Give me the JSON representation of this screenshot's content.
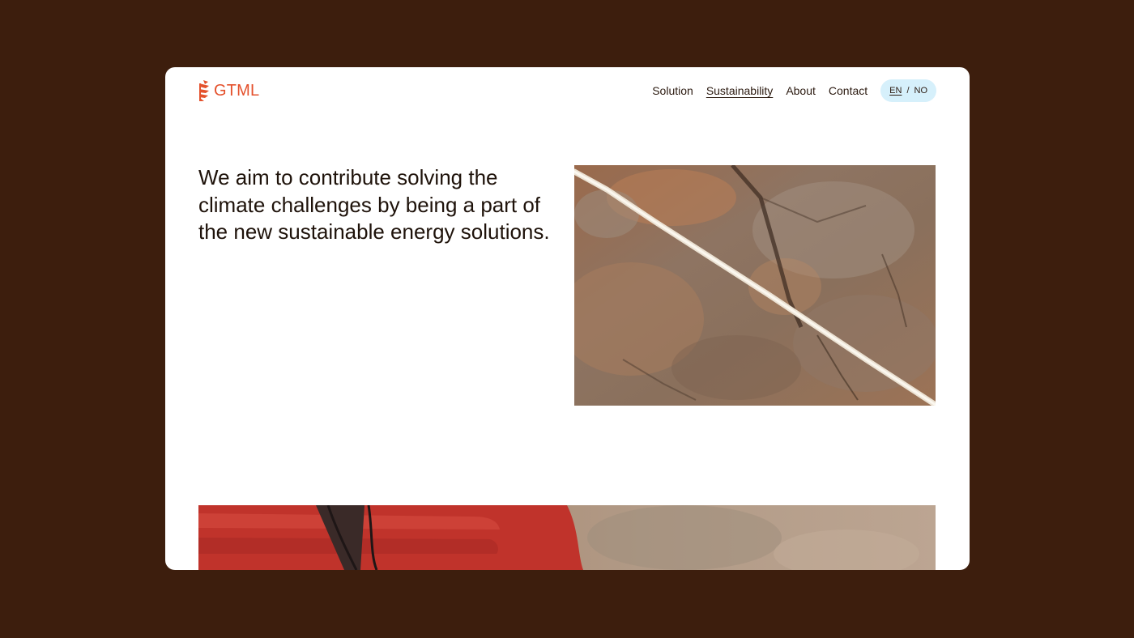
{
  "brand": {
    "name": "GTML",
    "color": "#e4512c",
    "icon": "gtml-leaf-logo-icon"
  },
  "nav": {
    "items": [
      {
        "label": "Solution",
        "active": false
      },
      {
        "label": "Sustainability",
        "active": true
      },
      {
        "label": "About",
        "active": false
      },
      {
        "label": "Contact",
        "active": false
      }
    ],
    "lang": {
      "en": "EN",
      "separator": "/",
      "no": "NO",
      "selected": "EN"
    }
  },
  "hero": {
    "headline": "We aim to contribute solving the climate challenges by being a part of the new sustainable energy solutions."
  },
  "colors": {
    "page_background": "#3d1e0d",
    "lang_pill": "#d6f0fb",
    "text": "#1e120a"
  }
}
